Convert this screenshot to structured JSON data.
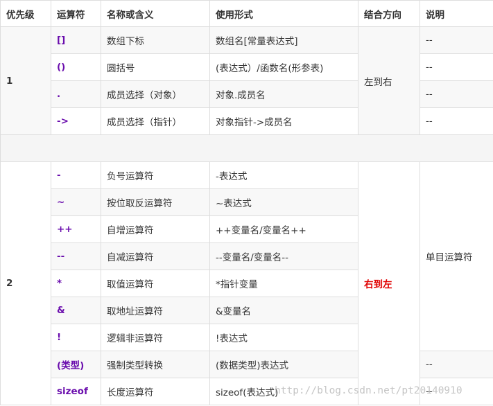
{
  "headers": [
    "优先级",
    "运算符",
    "名称或含义",
    "使用形式",
    "结合方向",
    "说明"
  ],
  "group1": {
    "priority": "1",
    "associativity": "左到右",
    "rows": [
      {
        "op": "[]",
        "name": "数组下标",
        "usage": "数组名[常量表达式]",
        "note": "--"
      },
      {
        "op": "()",
        "name": "圆括号",
        "usage": "(表达式）/函数名(形参表)",
        "note": "--"
      },
      {
        "op": ".",
        "name": "成员选择（对象）",
        "usage": "对象.成员名",
        "note": "--"
      },
      {
        "op": "->",
        "name": "成员选择（指针）",
        "usage": "对象指针->成员名",
        "note": "--"
      }
    ]
  },
  "group2": {
    "priority": "2",
    "associativity": "右到左",
    "unary_note": "单目运算符",
    "rows": [
      {
        "op": "-",
        "name": "负号运算符",
        "usage": "-表达式"
      },
      {
        "op": "~",
        "name": "按位取反运算符",
        "usage": "~表达式"
      },
      {
        "op": "++",
        "name": "自增运算符",
        "usage": "++变量名/变量名++"
      },
      {
        "op": "--",
        "name": "自减运算符",
        "usage": "--变量名/变量名--"
      },
      {
        "op": "*",
        "name": "取值运算符",
        "usage": "*指针变量"
      },
      {
        "op": "&",
        "name": "取地址运算符",
        "usage": "&变量名"
      },
      {
        "op": "!",
        "name": "逻辑非运算符",
        "usage": "!表达式"
      },
      {
        "op": "(类型)",
        "name": "强制类型转换",
        "usage": "(数据类型)表达式",
        "note": "--"
      },
      {
        "op": "sizeof",
        "name": "长度运算符",
        "usage": "sizeof(表达式)",
        "note": "--"
      }
    ]
  },
  "watermark": "http://blog.csdn.net/pt20140910"
}
